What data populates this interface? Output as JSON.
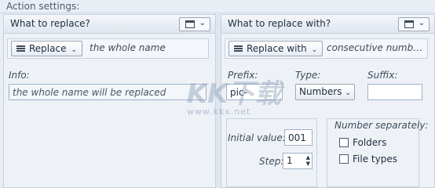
{
  "header": {
    "title": "Action settings:"
  },
  "left": {
    "title": "What to replace?",
    "dropdown_label": "Replace",
    "dropdown_description": "the whole name",
    "info_label": "Info:",
    "info_value": "the whole name will be replaced"
  },
  "right": {
    "title": "What to replace with?",
    "dropdown_label": "Replace with",
    "dropdown_description": "consecutive numberi...",
    "prefix_label": "Prefix:",
    "prefix_value": "pic-",
    "type_label": "Type:",
    "type_value": "Numbers",
    "suffix_label": "Suffix:",
    "suffix_value": "",
    "initial_value_label": "Initial value:",
    "initial_value": "001",
    "step_label": "Step:",
    "step_value": "1",
    "number_separately_label": "Number separately:",
    "checkbox_folders": "Folders",
    "checkbox_file_types": "File types"
  },
  "watermark": {
    "main": "KK下载",
    "sub": "www.kkx.net"
  }
}
